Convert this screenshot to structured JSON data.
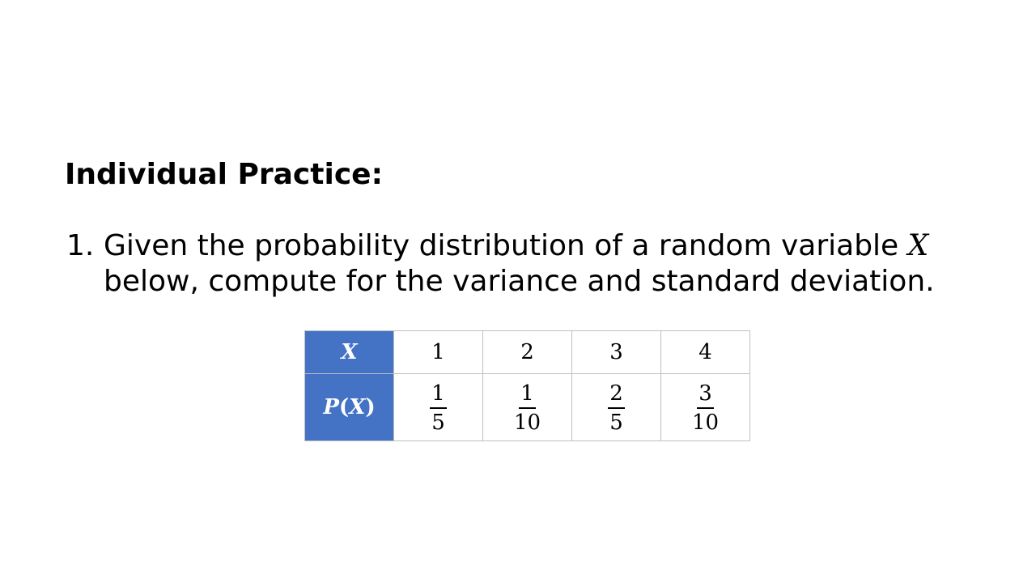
{
  "heading": "Individual Practice:",
  "question": {
    "number": "1.",
    "text_before_var": "Given the probability distribution of a random variable ",
    "variable": "X",
    "text_after_var": "below, compute for the variance and standard deviation."
  },
  "table": {
    "header_x": "X",
    "header_p_letter": "P",
    "header_p_open": "(",
    "header_p_var": "X",
    "header_p_close": ")",
    "x_values": [
      "1",
      "2",
      "3",
      "4"
    ],
    "probabilities": [
      {
        "numerator": "1",
        "denominator": "5"
      },
      {
        "numerator": "1",
        "denominator": "10"
      },
      {
        "numerator": "2",
        "denominator": "5"
      },
      {
        "numerator": "3",
        "denominator": "10"
      }
    ]
  },
  "colors": {
    "header_fill": "#4472c4",
    "header_text": "#ffffff",
    "border": "#bfbfbf"
  }
}
